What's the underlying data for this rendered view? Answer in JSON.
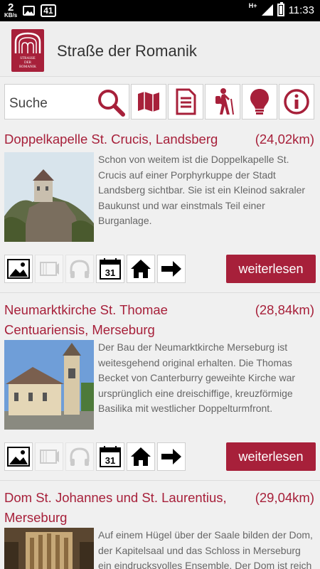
{
  "status_bar": {
    "net_speed": "2",
    "net_unit": "KB/s",
    "badge": "41",
    "network_type": "H+",
    "time": "11:33"
  },
  "app": {
    "title": "Straße der Romanik",
    "logo_text": [
      "STRASSE",
      "DER",
      "ROMANIK"
    ],
    "accent": "#a7203a"
  },
  "toolbar": {
    "search_placeholder": "Suche",
    "buttons": [
      "search-icon",
      "map-icon",
      "document-icon",
      "hiker-icon",
      "lightbulb-icon",
      "info-icon"
    ]
  },
  "calendar_day": "31",
  "more_label": "weiterlesen",
  "items": [
    {
      "title": "Doppelkapelle St. Crucis, Landsberg",
      "distance": "(24,02km)",
      "description": "Schon von weitem ist die Doppelkapelle St. Crucis auf einer Porphyrkuppe der Stadt Landsberg sichtbar. Sie ist ein Kleinod sakraler Baukunst und war einstmals Teil einer Burganlage."
    },
    {
      "title": "Neumarktkirche St. Thomae Centuariensis, Merseburg",
      "distance": "(28,84km)",
      "description": "Der Bau der Neumarktkirche Merseburg ist weitesgehend original erhalten. Die Thomas Becket von Canterburry geweihte Kirche war ursprünglich eine dreischiffige, kreuzförmige Basilika mit westlicher Doppelturmfront."
    },
    {
      "title": "Dom St. Johannes und St. Laurentius, Merseburg",
      "distance": "(29,04km)",
      "description": "Auf einem Hügel über der Saale bilden der Dom, der Kapitelsaal und das Schloss in Merseburg ein eindrucksvolles Ensemble. Der Dom ist reich mit"
    }
  ]
}
